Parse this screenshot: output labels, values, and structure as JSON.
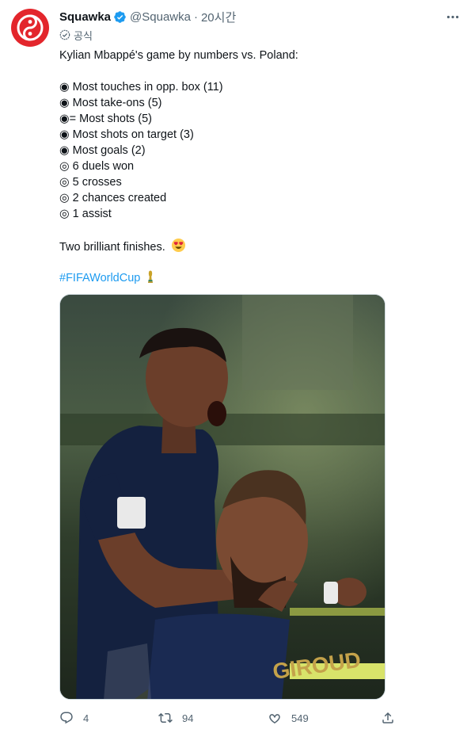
{
  "account": {
    "display_name": "Squawka",
    "handle": "@Squawka",
    "separator": "·",
    "time": "20시간",
    "official_label": "공식",
    "brand_color": "#e3262c",
    "verified_color": "#1d9bf0"
  },
  "tweet": {
    "intro": "Kylian Mbappé's game by numbers vs. Poland:",
    "stats": [
      "◉ Most touches in opp. box (11)",
      "◉ Most take-ons (5)",
      "◉= Most shots (5)",
      "◉ Most shots on target (3)",
      "◉ Most goals (2)",
      "◎ 6 duels won",
      "◎ 5 crosses",
      "◎ 2 chances created",
      "◎ 1 assist"
    ],
    "closing": "Two brilliant finishes.",
    "closing_emoji": "heart-eyes-emoji",
    "hashtag": "#FIFAWorldCup",
    "hashtag_emoji": "trophy-emoji"
  },
  "media": {
    "jersey_name": "GIROUD",
    "icon": "photo-two-france-players-celebrating"
  },
  "actions": {
    "replies": "4",
    "retweets": "94",
    "likes": "549",
    "reply_icon": "reply-icon",
    "retweet_icon": "retweet-icon",
    "like_icon": "heart-icon",
    "share_icon": "share-icon"
  }
}
